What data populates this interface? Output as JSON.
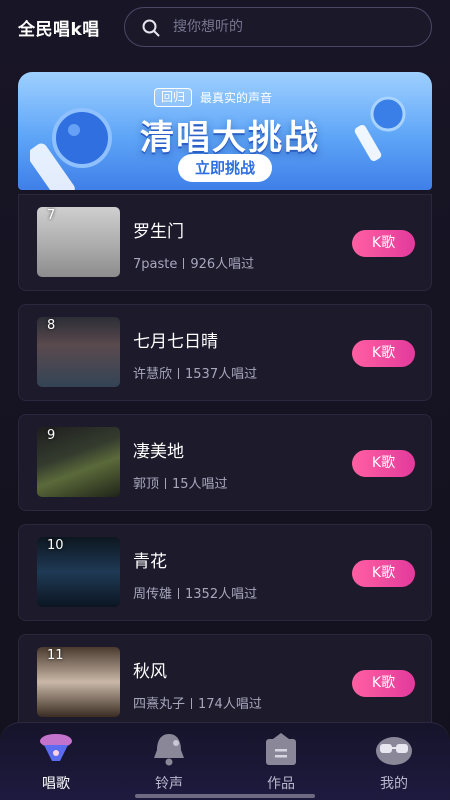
{
  "header": {
    "app_title": "全民唱k唱",
    "search_placeholder": "搜你想听的"
  },
  "banner": {
    "tag": "回归",
    "subtitle": "最真实的声音",
    "title": "清唱大挑战",
    "button_label": "立即挑战"
  },
  "songs": [
    {
      "rank": "7",
      "title": "罗生门",
      "artist": "7paste",
      "count": "926人唱过",
      "button": "K歌"
    },
    {
      "rank": "8",
      "title": "七月七日晴",
      "artist": "许慧欣",
      "count": "1537人唱过",
      "button": "K歌"
    },
    {
      "rank": "9",
      "title": "凄美地",
      "artist": "郭顶",
      "count": "15人唱过",
      "button": "K歌"
    },
    {
      "rank": "10",
      "title": "青花",
      "artist": "周传雄",
      "count": "1352人唱过",
      "button": "K歌"
    },
    {
      "rank": "11",
      "title": "秋风",
      "artist": "四熹丸子",
      "count": "174人唱过",
      "button": "K歌"
    }
  ],
  "nav": {
    "items": [
      {
        "label": "唱歌",
        "icon": "mic-icon",
        "active": true
      },
      {
        "label": "铃声",
        "icon": "bell-icon",
        "active": false
      },
      {
        "label": "作品",
        "icon": "works-icon",
        "active": false
      },
      {
        "label": "我的",
        "icon": "profile-icon",
        "active": false
      }
    ]
  },
  "colors": {
    "background": "#14121f",
    "accent_pink": "#ff5fa2",
    "banner_blue": "#5ea5f7"
  }
}
